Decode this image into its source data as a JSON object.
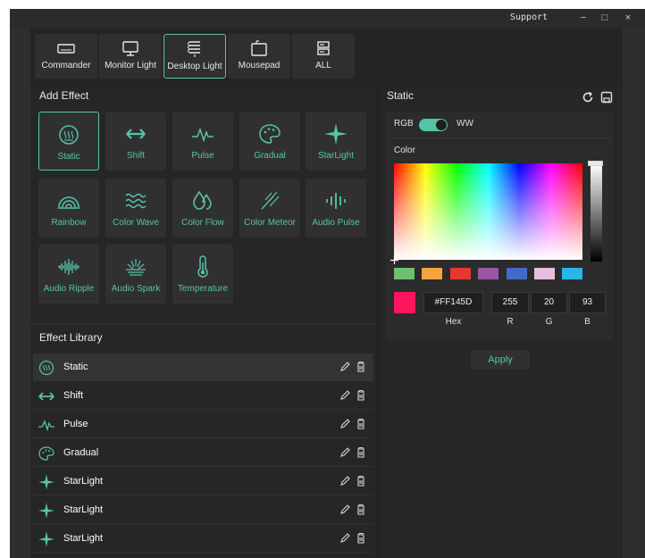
{
  "titlebar": {
    "support": "Support",
    "minimize": "−",
    "maximize": "□",
    "close": "×"
  },
  "devices": [
    {
      "label": "Commander",
      "icon": "keyboard-icon"
    },
    {
      "label": "Monitor Light",
      "icon": "monitor-icon"
    },
    {
      "label": "Desktop Light",
      "icon": "desktop-light-icon",
      "active": true
    },
    {
      "label": "Mousepad",
      "icon": "mousepad-icon"
    },
    {
      "label": "ALL",
      "icon": "all-devices-icon"
    }
  ],
  "add_effect": {
    "title": "Add Effect",
    "effects": [
      {
        "label": "Static",
        "icon": "static-icon",
        "active": true
      },
      {
        "label": "Shift",
        "icon": "shift-icon"
      },
      {
        "label": "Pulse",
        "icon": "pulse-icon"
      },
      {
        "label": "Gradual",
        "icon": "palette-icon"
      },
      {
        "label": "StarLight",
        "icon": "star-icon"
      },
      {
        "label": "Rainbow",
        "icon": "rainbow-icon"
      },
      {
        "label": "Color Wave",
        "icon": "wave-icon"
      },
      {
        "label": "Color Flow",
        "icon": "drops-icon"
      },
      {
        "label": "Color Meteor",
        "icon": "meteor-icon"
      },
      {
        "label": "Audio Pulse",
        "icon": "audio-pulse-icon"
      },
      {
        "label": "Audio Ripple",
        "icon": "audio-ripple-icon"
      },
      {
        "label": "Audio Spark",
        "icon": "audio-spark-icon"
      },
      {
        "label": "Temperature",
        "icon": "thermometer-icon"
      }
    ]
  },
  "library": {
    "title": "Effect Library",
    "items": [
      {
        "name": "Static",
        "icon": "static-icon",
        "active": true
      },
      {
        "name": "Shift",
        "icon": "shift-icon"
      },
      {
        "name": "Pulse",
        "icon": "pulse-icon"
      },
      {
        "name": "Gradual",
        "icon": "palette-icon"
      },
      {
        "name": "StarLight",
        "icon": "star-icon"
      },
      {
        "name": "StarLight",
        "icon": "star-icon"
      },
      {
        "name": "StarLight",
        "icon": "star-icon"
      }
    ]
  },
  "static_panel": {
    "title": "Static",
    "rgb_label": "RGB",
    "ww_label": "WW",
    "color_label": "Color",
    "swatches": [
      "#6cc070",
      "#f4a340",
      "#e8372f",
      "#9b55a6",
      "#4169c7",
      "#e7bedd",
      "#2ab7e8"
    ],
    "current_color": "#ff145d",
    "hex": "#FF145D",
    "r": "255",
    "g": "20",
    "b": "93",
    "hex_caption": "Hex",
    "r_caption": "R",
    "g_caption": "G",
    "b_caption": "B",
    "apply_label": "Apply"
  },
  "colors": {
    "accent": "#55c3a8",
    "background": "#242424"
  }
}
